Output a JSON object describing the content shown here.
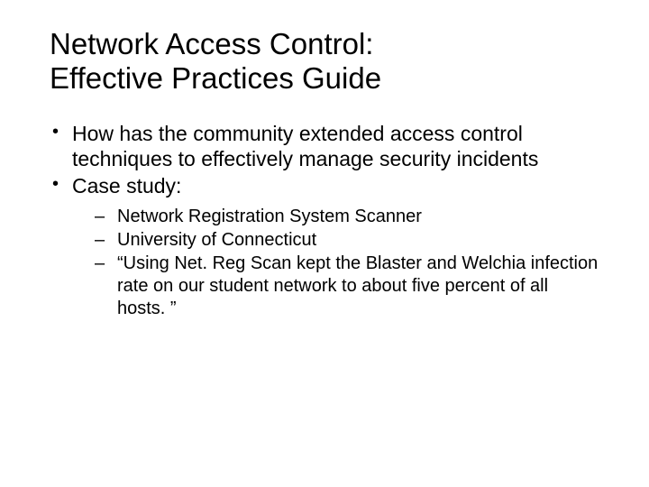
{
  "title_line1": "Network Access Control:",
  "title_line2": "Effective Practices Guide",
  "bullets": [
    "How has the community extended access control techniques to effectively manage security incidents",
    "Case study:"
  ],
  "sub_bullets": [
    "Network Registration System Scanner",
    "University of Connecticut",
    "“Using Net. Reg Scan kept the Blaster and Welchia infection rate on our student network to about five percent of all hosts. ”"
  ]
}
